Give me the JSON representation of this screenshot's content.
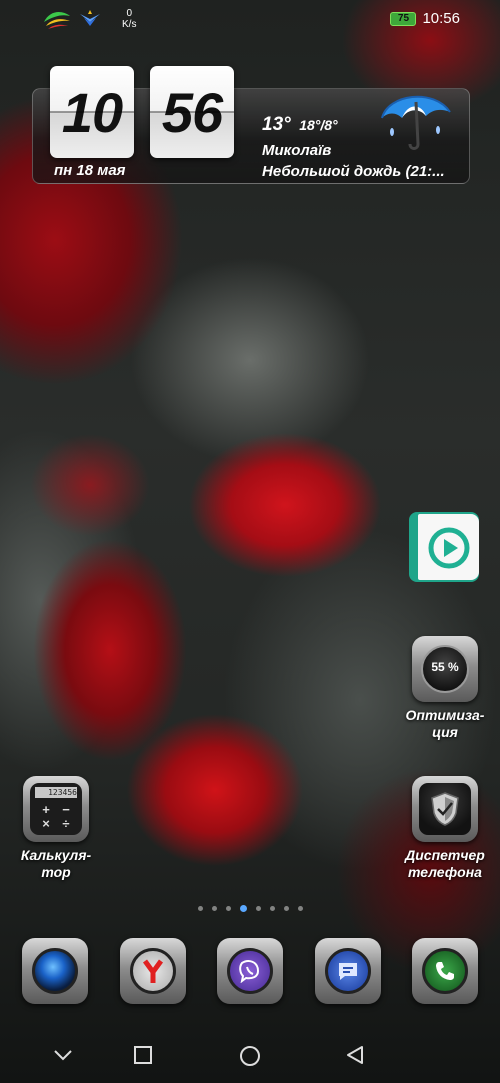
{
  "status_bar": {
    "speed_value": "0",
    "speed_unit": "K/s",
    "battery": "75",
    "time": "10:56"
  },
  "clock_widget": {
    "hours": "10",
    "minutes": "56",
    "date": "пн  18 мая"
  },
  "weather_widget": {
    "temperature": "13°",
    "range": "18°/8°",
    "city": "Миколаїв",
    "condition": "Небольшой дождь  (21:..."
  },
  "apps": {
    "video_player": {
      "label": ""
    },
    "optimization": {
      "label_line1": "Оптимиза-",
      "label_line2": "ция",
      "percent": "55 %"
    },
    "calculator": {
      "label_line1": "Калькуля-",
      "label_line2": "тор",
      "display": "123456"
    },
    "phone_manager": {
      "label_line1": "Диспетчер",
      "label_line2": "телефона"
    }
  },
  "page_indicator": {
    "count": 8,
    "active_index": 3
  },
  "dock": [
    "camera",
    "browser",
    "viber",
    "messages",
    "phone"
  ],
  "colors": {
    "accent": "#5aa8ff",
    "battery": "#3ea83a",
    "rose": "#d0141c"
  }
}
